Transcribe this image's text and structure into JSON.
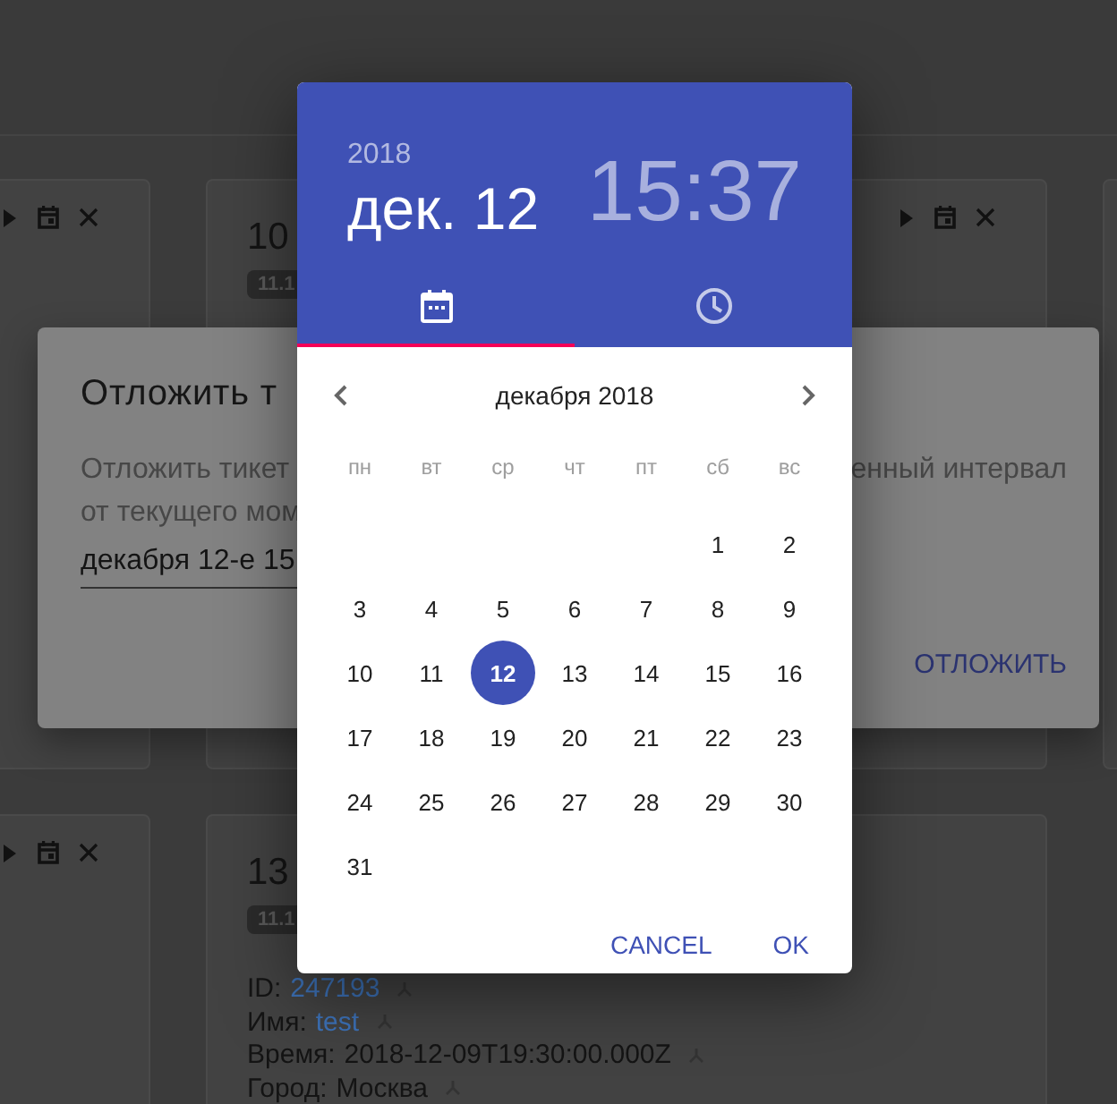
{
  "cards": [
    {
      "actions": true
    },
    {
      "actions": true,
      "title": "10",
      "badge": "11.1"
    },
    {
      "actions": true
    },
    {
      "actions": false,
      "title": "13",
      "badge": "11.1",
      "fields": [
        {
          "label": "ID:",
          "value": "247193",
          "link": true
        },
        {
          "label": "Имя:",
          "value": "test",
          "link": true
        },
        {
          "label": "Время:",
          "value": "2018-12-09T19:30:00.000Z",
          "link": false
        },
        {
          "label": "Город:",
          "value": "Москва",
          "link": false
        }
      ]
    }
  ],
  "dialog": {
    "title": "Отложить т",
    "line_1_start": "Отложить тикет",
    "line_1_end": "енный интервал",
    "line_2": "от текущего мом",
    "field_value": "декабря 12-е 15",
    "button": "ОТЛОЖИТЬ"
  },
  "picker": {
    "year": "2018",
    "date": "дек. 12",
    "time": "15:37",
    "tabs": [
      {
        "kind": "calendar",
        "selected": true
      },
      {
        "kind": "clock",
        "selected": false
      }
    ],
    "month": "декабря 2018",
    "weekdays": [
      "пн",
      "вт",
      "ср",
      "чт",
      "пт",
      "сб",
      "вс"
    ],
    "weeks": [
      {
        "days": [
          {
            "kind": "empty"
          },
          {
            "kind": "empty"
          },
          {
            "kind": "empty"
          },
          {
            "kind": "empty"
          },
          {
            "kind": "empty"
          },
          {
            "kind": "day",
            "label": "1",
            "selected": false
          },
          {
            "kind": "day",
            "label": "2",
            "selected": false
          }
        ]
      },
      {
        "days": [
          {
            "kind": "day",
            "label": "3",
            "selected": false
          },
          {
            "kind": "day",
            "label": "4",
            "selected": false
          },
          {
            "kind": "day",
            "label": "5",
            "selected": false
          },
          {
            "kind": "day",
            "label": "6",
            "selected": false
          },
          {
            "kind": "day",
            "label": "7",
            "selected": false
          },
          {
            "kind": "day",
            "label": "8",
            "selected": false
          },
          {
            "kind": "day",
            "label": "9",
            "selected": false
          }
        ]
      },
      {
        "days": [
          {
            "kind": "day",
            "label": "10",
            "selected": false
          },
          {
            "kind": "day",
            "label": "11",
            "selected": false
          },
          {
            "kind": "day",
            "label": "12",
            "selected": true
          },
          {
            "kind": "day",
            "label": "13",
            "selected": false
          },
          {
            "kind": "day",
            "label": "14",
            "selected": false
          },
          {
            "kind": "day",
            "label": "15",
            "selected": false
          },
          {
            "kind": "day",
            "label": "16",
            "selected": false
          }
        ]
      },
      {
        "days": [
          {
            "kind": "day",
            "label": "17",
            "selected": false
          },
          {
            "kind": "day",
            "label": "18",
            "selected": false
          },
          {
            "kind": "day",
            "label": "19",
            "selected": false
          },
          {
            "kind": "day",
            "label": "20",
            "selected": false
          },
          {
            "kind": "day",
            "label": "21",
            "selected": false
          },
          {
            "kind": "day",
            "label": "22",
            "selected": false
          },
          {
            "kind": "day",
            "label": "23",
            "selected": false
          }
        ]
      },
      {
        "days": [
          {
            "kind": "day",
            "label": "24",
            "selected": false
          },
          {
            "kind": "day",
            "label": "25",
            "selected": false
          },
          {
            "kind": "day",
            "label": "26",
            "selected": false
          },
          {
            "kind": "day",
            "label": "27",
            "selected": false
          },
          {
            "kind": "day",
            "label": "28",
            "selected": false
          },
          {
            "kind": "day",
            "label": "29",
            "selected": false
          },
          {
            "kind": "day",
            "label": "30",
            "selected": false
          }
        ]
      },
      {
        "days": [
          {
            "kind": "day",
            "label": "31",
            "selected": false
          }
        ]
      }
    ],
    "buttons": [
      "CANCEL",
      "OK"
    ]
  }
}
